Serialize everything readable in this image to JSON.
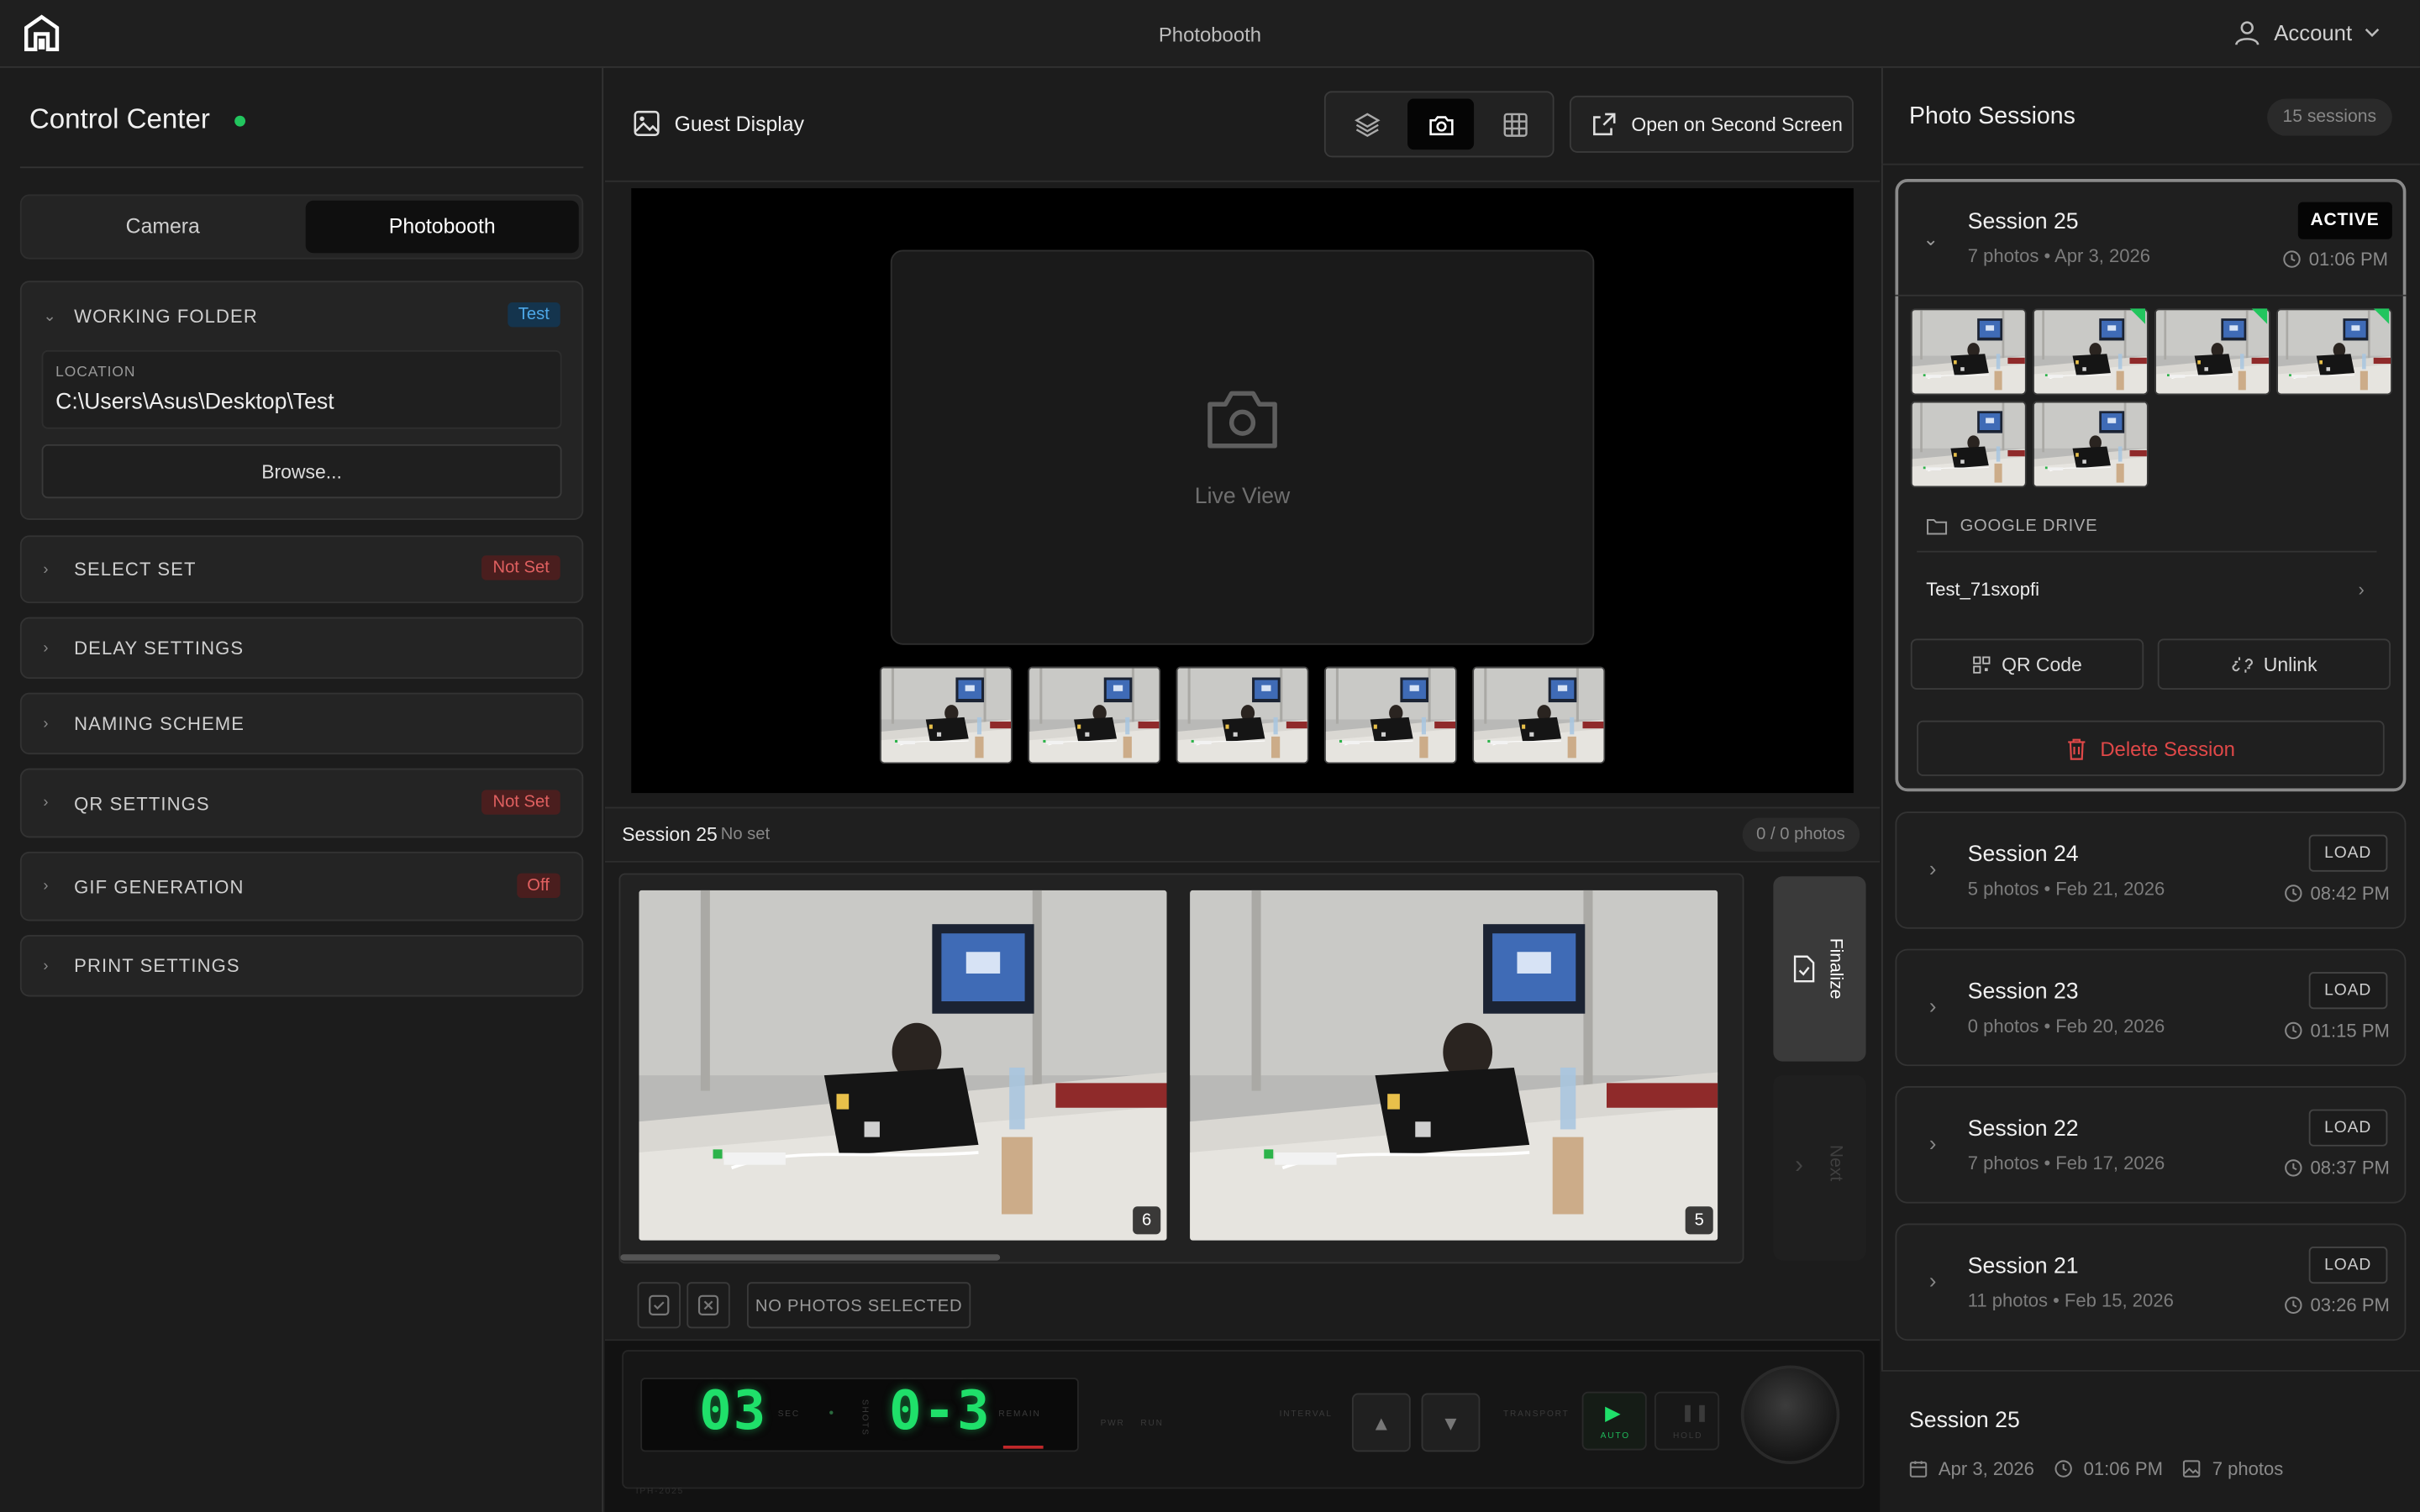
{
  "app": {
    "title": "Photobooth",
    "account_label": "Account"
  },
  "left": {
    "title": "Control Center",
    "tabs": [
      "Camera",
      "Photobooth"
    ],
    "working_folder": {
      "label": "WORKING FOLDER",
      "badge": "Test",
      "location_label": "LOCATION",
      "location_value": "C:\\Users\\Asus\\Desktop\\Test",
      "browse_label": "Browse..."
    },
    "sections": [
      {
        "label": "SELECT SET",
        "badge": "Not Set"
      },
      {
        "label": "DELAY SETTINGS",
        "badge": ""
      },
      {
        "label": "NAMING SCHEME",
        "badge": ""
      },
      {
        "label": "QR SETTINGS",
        "badge": "Not Set"
      },
      {
        "label": "GIF GENERATION",
        "badge": "Off"
      },
      {
        "label": "PRINT SETTINGS",
        "badge": ""
      }
    ]
  },
  "center": {
    "guest_display_label": "Guest Display",
    "open_second_screen_label": "Open on Second Screen",
    "live_view_label": "Live View",
    "session_name": "Session 25",
    "session_set": "No set",
    "photo_count": "0 / 0 photos",
    "gallery_numbers": [
      "6",
      "5"
    ],
    "finalize_label": "Finalize",
    "next_label": "Next",
    "no_selection_label": "NO PHOTOS SELECTED",
    "control": {
      "delay": "03",
      "delay_unit": "SEC",
      "count": "0-3",
      "remain_label": "REMAIN",
      "interval_label": "INTERVAL",
      "transport_label": "TRANSPORT",
      "auto_label": "AUTO",
      "hold_label": "HOLD",
      "pwr_label": "PWR",
      "run_label": "RUN",
      "shots_label": "SHOTS",
      "model": "IPH-2025"
    }
  },
  "right": {
    "title": "Photo Sessions",
    "count": "15 sessions",
    "active": {
      "name": "Session 25",
      "meta": "7 photos • Apr 3, 2026",
      "time": "01:06 PM",
      "badge": "ACTIVE",
      "gdrive_label": "GOOGLE DRIVE",
      "folder": "Test_71sxopfi",
      "qr_label": "QR Code",
      "unlink_label": "Unlink",
      "delete_label": "Delete Session"
    },
    "sessions": [
      {
        "name": "Session 24",
        "meta": "5 photos • Feb 21, 2026",
        "time": "08:42 PM",
        "action": "LOAD"
      },
      {
        "name": "Session 23",
        "meta": "0 photos • Feb 20, 2026",
        "time": "01:15 PM",
        "action": "LOAD"
      },
      {
        "name": "Session 22",
        "meta": "7 photos • Feb 17, 2026",
        "time": "08:37 PM",
        "action": "LOAD"
      },
      {
        "name": "Session 21",
        "meta": "11 photos • Feb 15, 2026",
        "time": "03:26 PM",
        "action": "LOAD"
      }
    ],
    "footer": {
      "name": "Session 25",
      "date": "Apr 3, 2026",
      "time": "01:06 PM",
      "photos": "7 photos"
    }
  }
}
